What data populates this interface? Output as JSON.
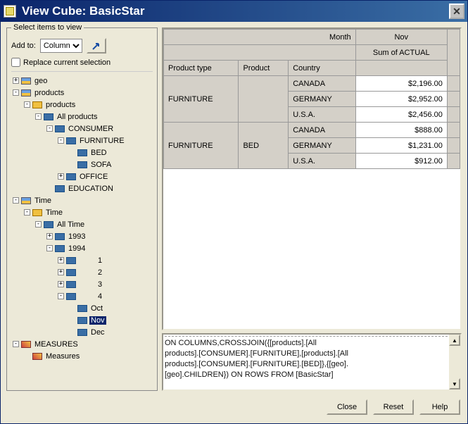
{
  "window": {
    "title": "View Cube: BasicStar"
  },
  "panel": {
    "legend": "Select items to view",
    "addto_label": "Add to:",
    "addto_value": "Column",
    "replace_label": "Replace current selection"
  },
  "tree": [
    {
      "depth": 0,
      "toggle": "+",
      "icon": "dim",
      "label": "geo"
    },
    {
      "depth": 0,
      "toggle": "-",
      "icon": "dim",
      "label": "products"
    },
    {
      "depth": 1,
      "toggle": "-",
      "icon": "hier",
      "label": "products"
    },
    {
      "depth": 2,
      "toggle": "-",
      "icon": "level",
      "label": "All products"
    },
    {
      "depth": 3,
      "toggle": "-",
      "icon": "level",
      "label": "CONSUMER"
    },
    {
      "depth": 4,
      "toggle": "-",
      "icon": "level",
      "label": "FURNITURE"
    },
    {
      "depth": 5,
      "toggle": "",
      "icon": "level",
      "label": "BED"
    },
    {
      "depth": 5,
      "toggle": "",
      "icon": "level",
      "label": "SOFA"
    },
    {
      "depth": 4,
      "toggle": "+",
      "icon": "level",
      "label": "OFFICE"
    },
    {
      "depth": 3,
      "toggle": "",
      "icon": "level",
      "label": "EDUCATION"
    },
    {
      "depth": 0,
      "toggle": "-",
      "icon": "dim",
      "label": "Time"
    },
    {
      "depth": 1,
      "toggle": "-",
      "icon": "hier",
      "label": "Time"
    },
    {
      "depth": 2,
      "toggle": "-",
      "icon": "level",
      "label": "All Time"
    },
    {
      "depth": 3,
      "toggle": "+",
      "icon": "level",
      "label": "1993"
    },
    {
      "depth": 3,
      "toggle": "-",
      "icon": "level",
      "label": "1994"
    },
    {
      "depth": 4,
      "toggle": "+",
      "icon": "level",
      "label": "1",
      "pad": true
    },
    {
      "depth": 4,
      "toggle": "+",
      "icon": "level",
      "label": "2",
      "pad": true
    },
    {
      "depth": 4,
      "toggle": "+",
      "icon": "level",
      "label": "3",
      "pad": true
    },
    {
      "depth": 4,
      "toggle": "-",
      "icon": "level",
      "label": "4",
      "pad": true
    },
    {
      "depth": 5,
      "toggle": "",
      "icon": "level",
      "label": "Oct"
    },
    {
      "depth": 5,
      "toggle": "",
      "icon": "level",
      "label": "Nov",
      "selected": true
    },
    {
      "depth": 5,
      "toggle": "",
      "icon": "level",
      "label": "Dec"
    },
    {
      "depth": 0,
      "toggle": "-",
      "icon": "meas",
      "label": "MEASURES"
    },
    {
      "depth": 1,
      "toggle": "",
      "icon": "meas",
      "label": "Measures"
    }
  ],
  "grid": {
    "top_headers": {
      "month": "Month",
      "nov": "Nov",
      "sum": "Sum of ACTUAL"
    },
    "col_headers": {
      "ptype": "Product type",
      "product": "Product",
      "country": "Country"
    },
    "rows": [
      {
        "ptype": "FURNITURE",
        "product": "",
        "country": "CANADA",
        "val": "$2,196.00",
        "span_ptype": 3,
        "span_product": 3
      },
      {
        "ptype": "",
        "product": "",
        "country": "GERMANY",
        "val": "$2,952.00"
      },
      {
        "ptype": "",
        "product": "",
        "country": "U.S.A.",
        "val": "$2,456.00"
      },
      {
        "ptype": "FURNITURE",
        "product": "BED",
        "country": "CANADA",
        "val": "$888.00",
        "span_ptype": 3,
        "span_product": 3
      },
      {
        "ptype": "",
        "product": "",
        "country": "GERMANY",
        "val": "$1,231.00"
      },
      {
        "ptype": "",
        "product": "",
        "country": "U.S.A.",
        "val": "$912.00"
      }
    ]
  },
  "query": {
    "line1": "ON COLUMNS,CROSSJOIN({[products].[All",
    "line2": "products].[CONSUMER].[FURNITURE],[products].[All",
    "line3": "products].[CONSUMER].[FURNITURE].[BED]},{[geo].",
    "line4": "[geo].CHILDREN}) ON ROWS FROM [BasicStar]"
  },
  "buttons": {
    "close": "Close",
    "reset": "Reset",
    "help": "Help"
  }
}
